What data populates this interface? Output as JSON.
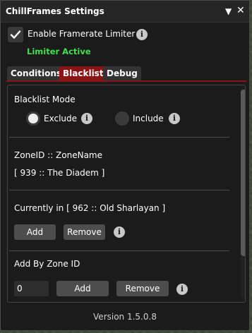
{
  "window": {
    "title": "ChillFrames Settings",
    "collapse_glyph": "▼",
    "close_glyph": "✕"
  },
  "enable": {
    "label": "Enable Framerate Limiter",
    "checked": true,
    "status": "Limiter Active"
  },
  "tabs": [
    {
      "label": "Conditions",
      "active": false
    },
    {
      "label": "Blacklist",
      "active": true
    },
    {
      "label": "Debug",
      "active": false
    }
  ],
  "blacklist": {
    "mode_label": "Blacklist Mode",
    "mode_options": [
      {
        "label": "Exclude",
        "selected": true
      },
      {
        "label": "Include",
        "selected": false
      }
    ],
    "zone_header": "ZoneID :: ZoneName",
    "zone_entries": [
      "[ 939 :: The Diadem ]"
    ],
    "current_label": "Currently in [ 962 :: Old Sharlayan ]",
    "add_label": "Add",
    "remove_label": "Remove",
    "add_by_id_label": "Add By Zone ID",
    "zone_id_value": "0"
  },
  "footer": {
    "version": "Version 1.5.0.8"
  },
  "colors": {
    "accent": "#8a1414",
    "status": "#3ee24a"
  },
  "icons": {
    "info": "i"
  }
}
